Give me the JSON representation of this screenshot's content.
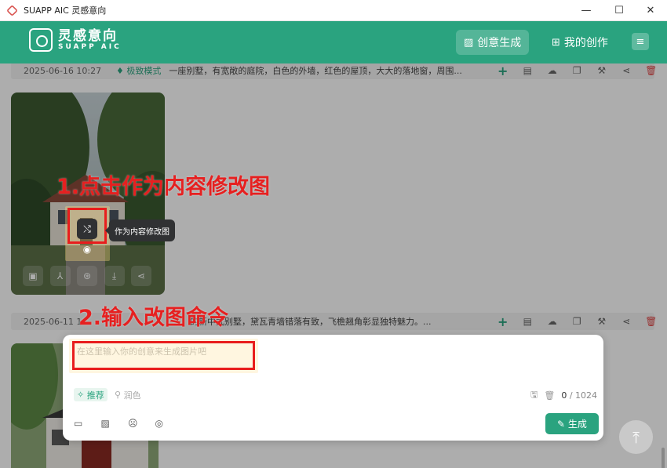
{
  "window": {
    "title": "SUAPP AIC 灵感意向",
    "controls": {
      "minimize": "—",
      "maximize": "☐",
      "close": "✕"
    }
  },
  "header": {
    "logo_cn": "灵感意向",
    "logo_en": "SUAPP AIC",
    "nav": [
      {
        "label": "创意生成",
        "icon": "image-icon"
      },
      {
        "label": "我的创作",
        "icon": "grid-icon"
      }
    ],
    "menu_icon": "≡"
  },
  "records": [
    {
      "date": "2025-06-16 10:27",
      "mode": "极致模式",
      "prompt": "一座别墅，有宽敞的庭院，白色的外墙，红色的屋顶，大大的落地窗，周围...",
      "more": "..."
    },
    {
      "date": "2025-06-11 1",
      "mode": "",
      "prompt": "的新中式别墅，黛瓦青墙错落有致，飞檐翘角彰显独特魅力。...",
      "more": "..."
    }
  ],
  "row_actions": [
    {
      "name": "add",
      "glyph": "+"
    },
    {
      "name": "copy-text",
      "glyph": "▤"
    },
    {
      "name": "upload",
      "glyph": "☁"
    },
    {
      "name": "duplicate",
      "glyph": "❐"
    },
    {
      "name": "magic",
      "glyph": "⚒"
    },
    {
      "name": "share",
      "glyph": "⋖"
    },
    {
      "name": "delete",
      "glyph": "🗑"
    }
  ],
  "card_tools": [
    "▣",
    "⅄",
    "⊛",
    "⤓",
    "⋖"
  ],
  "tooltip": "作为内容修改图",
  "annotations": {
    "step1": "1.点击作为内容修改图",
    "step2": "2.输入改图命令"
  },
  "panel": {
    "placeholder": "在这里输入你的创意来生成图片吧",
    "chip_recommend": "推荐",
    "chip_polish": "润色",
    "count_current": "0",
    "count_max": "1024",
    "generate": "生成"
  },
  "colors": {
    "brand": "#2aa37f",
    "annotation": "#e81d1d",
    "delete": "#e04a4a"
  }
}
